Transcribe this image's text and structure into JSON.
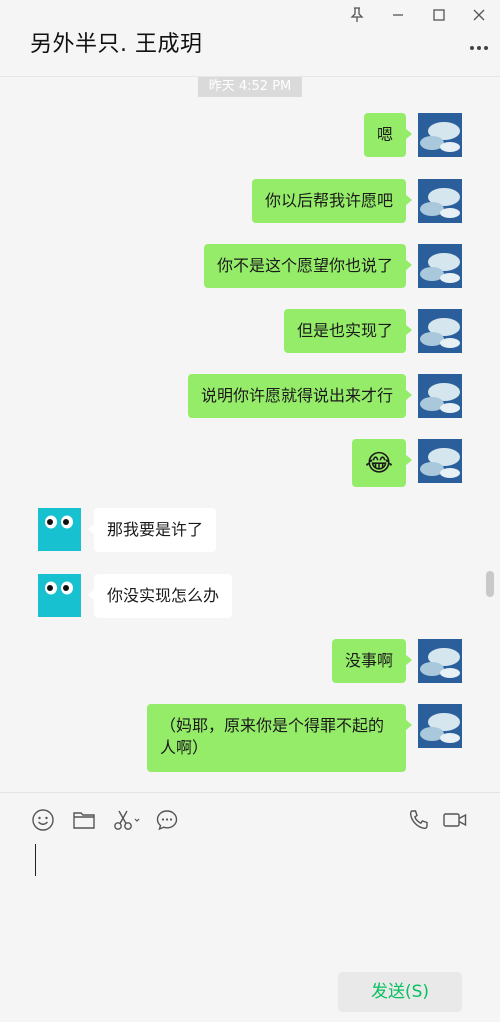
{
  "header": {
    "title": "另外半只. 王成玥"
  },
  "chat": {
    "timestamp": "昨天 4:52 PM",
    "messages": [
      {
        "side": "me",
        "text": "嗯"
      },
      {
        "side": "me",
        "text": "你以后帮我许愿吧"
      },
      {
        "side": "me",
        "text": "你不是这个愿望你也说了"
      },
      {
        "side": "me",
        "text": "但是也实现了"
      },
      {
        "side": "me",
        "text": "说明你许愿就得说出来才行"
      },
      {
        "side": "me",
        "emoji": "😂"
      },
      {
        "side": "other",
        "text": "那我要是许了"
      },
      {
        "side": "other",
        "text": "你没实现怎么办"
      },
      {
        "side": "me",
        "text": "没事啊"
      },
      {
        "side": "me",
        "text": "（妈耶，原来你是个得罪不起的人啊）"
      }
    ]
  },
  "footer": {
    "send_label": "发送(S)"
  },
  "colors": {
    "my_bubble": "#95ec69",
    "other_bubble": "#ffffff",
    "send_text": "#07c160",
    "other_avatar_bg": "#17c1cf"
  }
}
